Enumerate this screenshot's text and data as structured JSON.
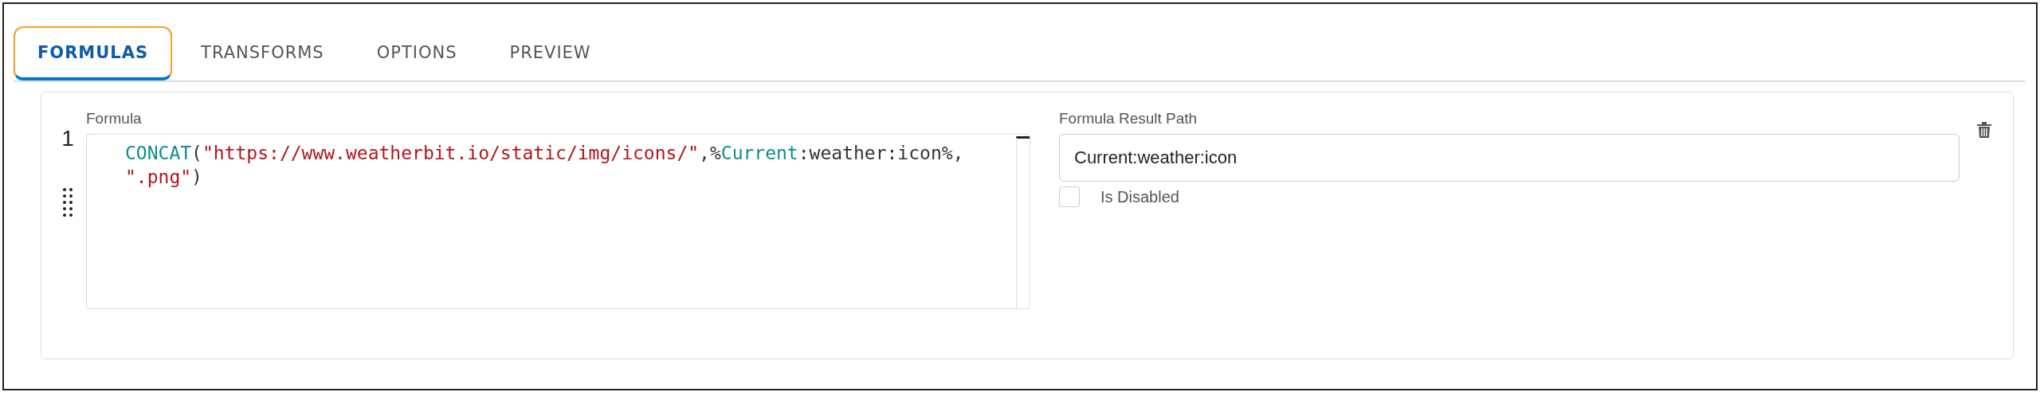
{
  "tabs": [
    {
      "label": "FORMULAS",
      "selected": true,
      "highlighted": true
    },
    {
      "label": "TRANSFORMS",
      "selected": false,
      "highlighted": false
    },
    {
      "label": "OPTIONS",
      "selected": false,
      "highlighted": false
    },
    {
      "label": "PREVIEW",
      "selected": false,
      "highlighted": false
    }
  ],
  "formulas": [
    {
      "number": "1",
      "formula_label": "Formula",
      "code_lines": [
        [
          {
            "kind": "function",
            "text": "CONCAT"
          },
          {
            "kind": "plain",
            "text": "("
          },
          {
            "kind": "string",
            "text": "\"https://www.weatherbit.io/static/img/icons/\""
          },
          {
            "kind": "plain",
            "text": ",%"
          },
          {
            "kind": "variable",
            "text": "Current"
          },
          {
            "kind": "plain",
            "text": ":weather:icon%,"
          }
        ],
        [
          {
            "kind": "string",
            "text": "\".png\""
          },
          {
            "kind": "plain",
            "text": ")"
          }
        ]
      ],
      "result_label": "Formula Result Path",
      "result_value": "Current:weather:icon",
      "disabled_label": "Is Disabled",
      "disabled_checked": false
    }
  ]
}
